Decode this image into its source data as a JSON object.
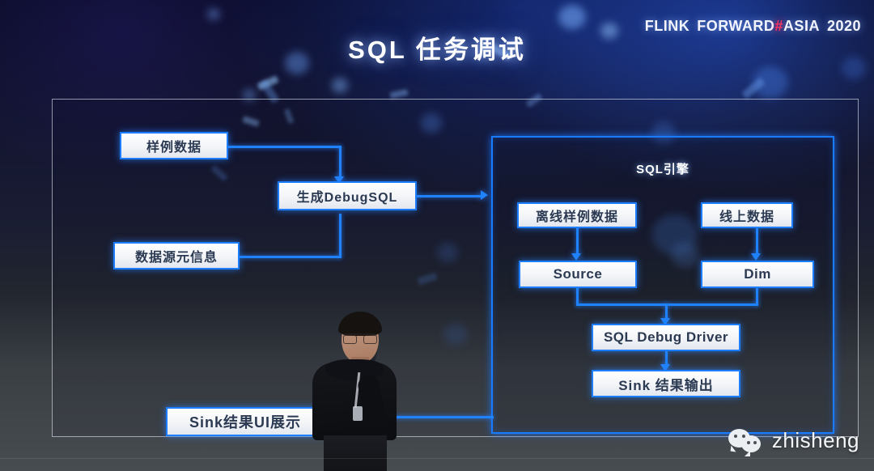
{
  "slide": {
    "title": "SQL 任务调试",
    "brand": {
      "part1": "FLINK",
      "part2": "FORWARD",
      "hash": "#",
      "part3": "ASIA",
      "year": "2020"
    }
  },
  "diagram": {
    "left_nodes": [
      {
        "id": "sample-data",
        "label": "样例数据"
      },
      {
        "id": "generate-debug-sql",
        "label": "生成DebugSQL"
      },
      {
        "id": "datasource-meta",
        "label": "数据源元信息"
      },
      {
        "id": "sink-result-ui",
        "label": "Sink结果UI展示"
      }
    ],
    "panel": {
      "title": "SQL引擎",
      "nodes": [
        {
          "id": "offline-sample-data",
          "label": "离线样例数据"
        },
        {
          "id": "online-data",
          "label": "线上数据"
        },
        {
          "id": "source",
          "label": "Source"
        },
        {
          "id": "dim",
          "label": "Dim"
        },
        {
          "id": "sql-debug-driver",
          "label": "SQL Debug Driver"
        },
        {
          "id": "sink-output",
          "label": "Sink 结果输出"
        }
      ]
    }
  },
  "watermark": {
    "name": "zhisheng",
    "icon": "wechat-icon"
  },
  "colors": {
    "accent_blue": "#1f82ff",
    "box_fill": "#ffffff",
    "box_text": "#2b3a52",
    "brand_hash_red": "#ff2f5e",
    "frame_border": "#e1e6f0"
  }
}
